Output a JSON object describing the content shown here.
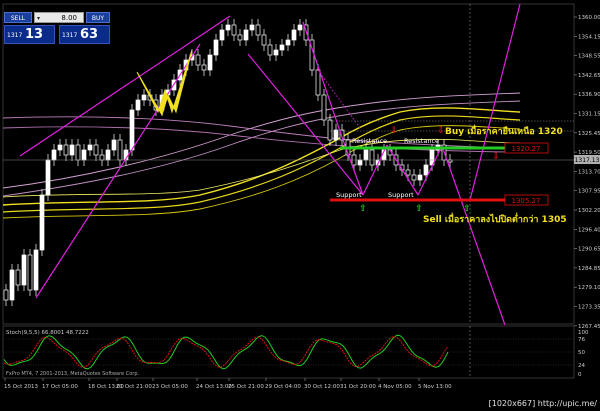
{
  "trade_panel": {
    "sell_label": "SELL",
    "buy_label": "BUY",
    "lot_value": "8.00",
    "bid_prefix": "1317",
    "bid_big": "13",
    "ask_prefix": "1317",
    "ask_big": "63"
  },
  "price_axis": [
    "1360.00",
    "1354.15",
    "1348.55",
    "1342.65",
    "1336.90",
    "1331.15",
    "1325.45",
    "1319.50",
    "1313.70",
    "1307.95",
    "1302.20",
    "1296.40",
    "1290.65",
    "1284.85",
    "1279.10",
    "1273.35",
    "1267.45"
  ],
  "current_price_label": "1317.13",
  "level_1320_label": "1320.27",
  "level_1305_label": "1305.27",
  "annotations": {
    "buy_text": "Buy เมื่อราคายืนเหนือ 1320",
    "sell_text": "Sell เมื่อราคาลงไปปิดต่ำกว่า 1305",
    "resistance_1": "Resistance",
    "resistance_2": "Resistance",
    "support_1": "Support",
    "support_2": "Support"
  },
  "indicator": {
    "title": "Stoch(9,5,5) 66.8001 48.7222",
    "axis": [
      "100",
      "76",
      "50",
      "24",
      "0"
    ]
  },
  "copyright": "FxPro MT4, 7 2001-2013, MetaQuotes Software Corp.",
  "time_axis": [
    "15 Oct 2013",
    "17 Oct 05:00",
    "18 Oct 13:00",
    "21 Oct 21:00",
    "23 Oct 05:00",
    "24 Oct 13:00",
    "25 Oct 21:00",
    "29 Oct 04:00",
    "30 Oct 12:00",
    "31 Oct 20:00",
    "4 Nov 05:00",
    "5 Nov 13:00"
  ],
  "watermark": "[1020x667] http://upic.me/",
  "colors": {
    "magenta": "#e020e0",
    "green": "#22cc22",
    "red": "#e01010",
    "yellow": "#f0e020",
    "grid": "#333333"
  }
}
